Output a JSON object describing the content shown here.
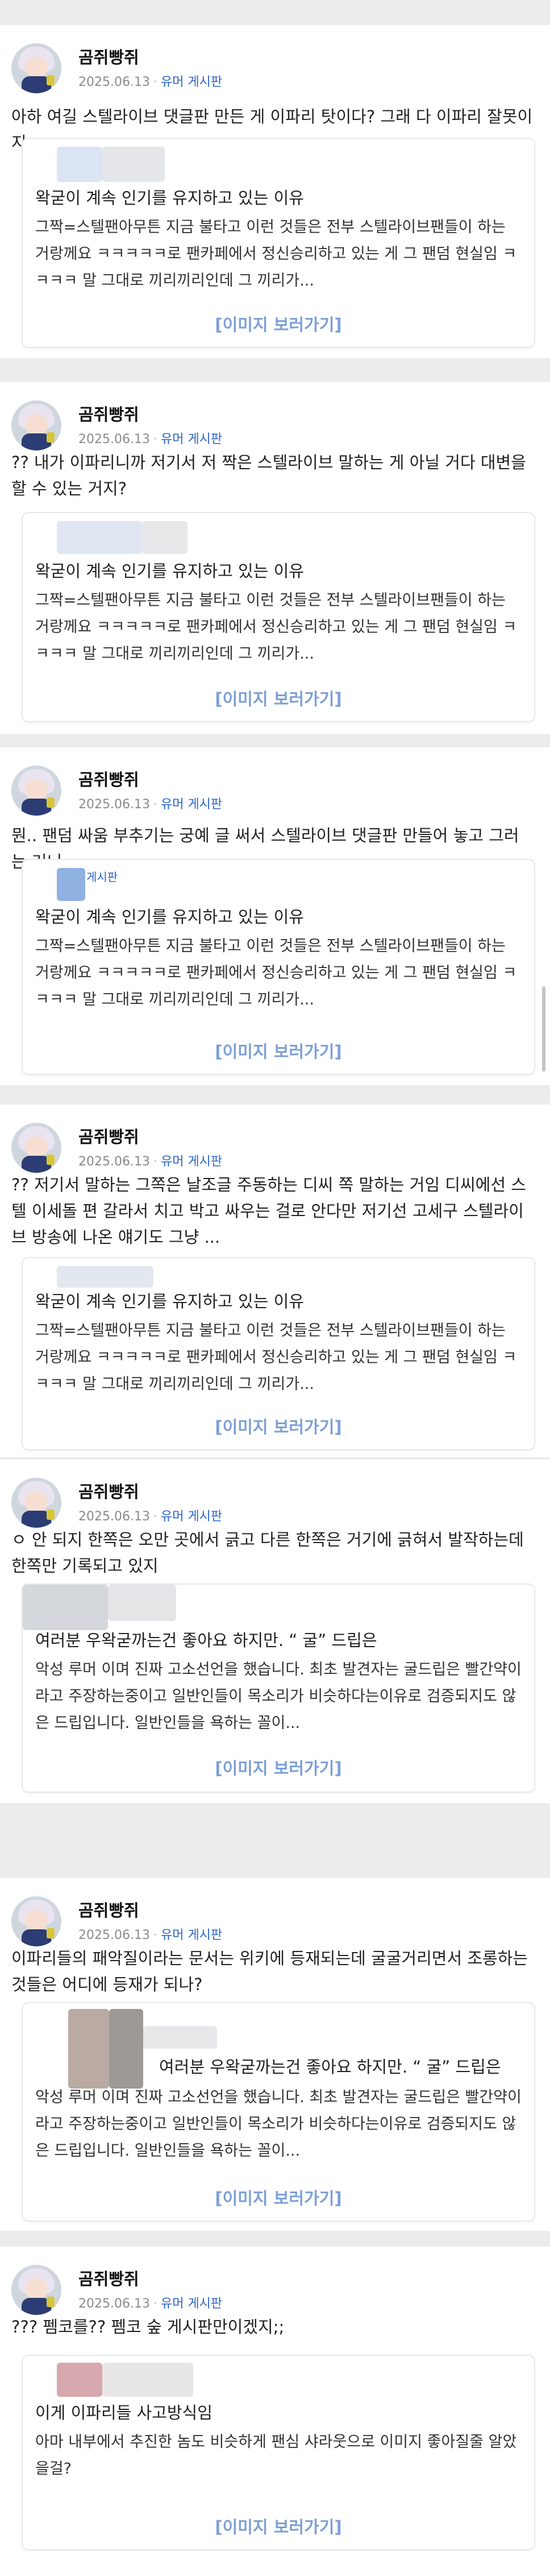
{
  "author_name": "곰쥐빵쥐",
  "date": "2025.06.13",
  "board": "유머 게시판",
  "view_image_label": "[이미지 보러가기]",
  "card_board_label": "게시판",
  "preview_a": {
    "title": "왁굳이 계속 인기를 유지하고 있는 이유",
    "body": "그짝=스텔팬아무튼 지금 불타고 이런 것들은 전부 스텔라이브팬들이 하는 거랑께요 ㅋㅋㅋㅋㅋ로 팬카페에서 정신승리하고 있는 게 그 팬덤 현실임 ㅋㅋㅋㅋ 말 그대로 끼리끼리인데 그 끼리가..."
  },
  "preview_b": {
    "title": "여러분 우왁굳까는건 좋아요 하지만. “ 굴” 드립은",
    "body": "악성 루머 이며 진짜 고소선언을 했습니다. 최초 발견자는 굴드립은 빨간약이라고 주장하는중이고 일반인들이 목소리가 비슷하다는이유로 검증되지도 않은 드립입니다. 일반인들을 욕하는 꼴이..."
  },
  "preview_c": {
    "title": "이게 이파리들 사고방식임",
    "body": "아마 내부에서 추진한 놈도 비슷하게 팬심 샤라웃으로 이미지 좋아질줄 알았을걸?"
  },
  "comments": [
    {
      "text": "아하 여길 스텔라이브 댓글판 만든 게 이파리 탓이다? 그래 다 이파리 잘못이지"
    },
    {
      "text": "?? 내가 이파리니까 저기서 저 짝은 스텔라이브 말하는 게 아닐 거다 대변을 할 수 있는 거지?"
    },
    {
      "text": "뭔.. 팬덤 싸움 부추기는 궁예 글 써서 스텔라이브 댓글판 만들어 놓고 그러는 거니"
    },
    {
      "text": "?? 저기서 말하는 그쪽은 날조글 주동하는 디씨 쪽 말하는 거임 디씨에선 스텔 이세돌 편 갈라서 치고 박고 싸우는 걸로 안다만 저기선 고세구 스텔라이브 방송에 나온 얘기도 그냥 ..."
    },
    {
      "text": "ㅇ 안 되지 한쪽은 오만 곳에서 긁고 다른 한쪽은 거기에 긁혀서 발작하는데 한쪽만 기록되고 있지"
    },
    {
      "text": "이파리들의 패악질이라는 문서는 위키에 등재되는데 굴굴거리면서 조롱하는 것들은 어디에 등재가 되나?"
    },
    {
      "text": "??? 펨코를?? 펨코 숲 게시판만이겠지;;"
    }
  ]
}
